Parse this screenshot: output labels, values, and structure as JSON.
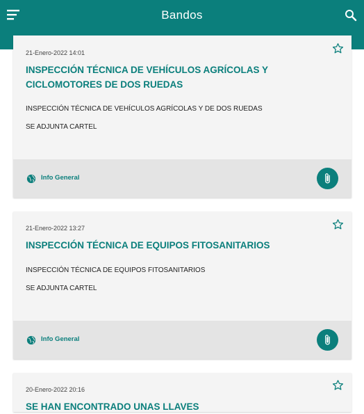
{
  "header": {
    "title": "Bandos",
    "menu_icon": "menu-icon",
    "search_icon": "search-icon"
  },
  "colors": {
    "accent": "#0b7f7c",
    "card_bg": "#f4f4f4",
    "footer_bg": "#e4e4e4"
  },
  "cards": [
    {
      "date": "21-Enero-2022 14:01",
      "title_line1": "INSPECCIÓN TÉCNICA DE VEHÍCULOS AGRÍCOLAS Y",
      "title_line2": "CICLOMOTORES  DE DOS RUEDAS",
      "body_line1": "INSPECCIÓN TÉCNICA DE VEHÍCULOS AGRÍCOLAS Y DE DOS RUEDAS",
      "body_line2": "SE ADJUNTA CARTEL",
      "category": "Info General"
    },
    {
      "date": "21-Enero-2022 13:27",
      "title_line1": "INSPECCIÓN TÉCNICA DE EQUIPOS FITOSANITARIOS",
      "body_line1": "INSPECCIÓN TÉCNICA DE EQUIPOS FITOSANITARIOS",
      "body_line2": "SE ADJUNTA CARTEL",
      "category": "Info General"
    },
    {
      "date": "20-Enero-2022 20:16",
      "title_line1": "SE HAN  ENCONTRADO  UNAS LLAVES"
    }
  ]
}
